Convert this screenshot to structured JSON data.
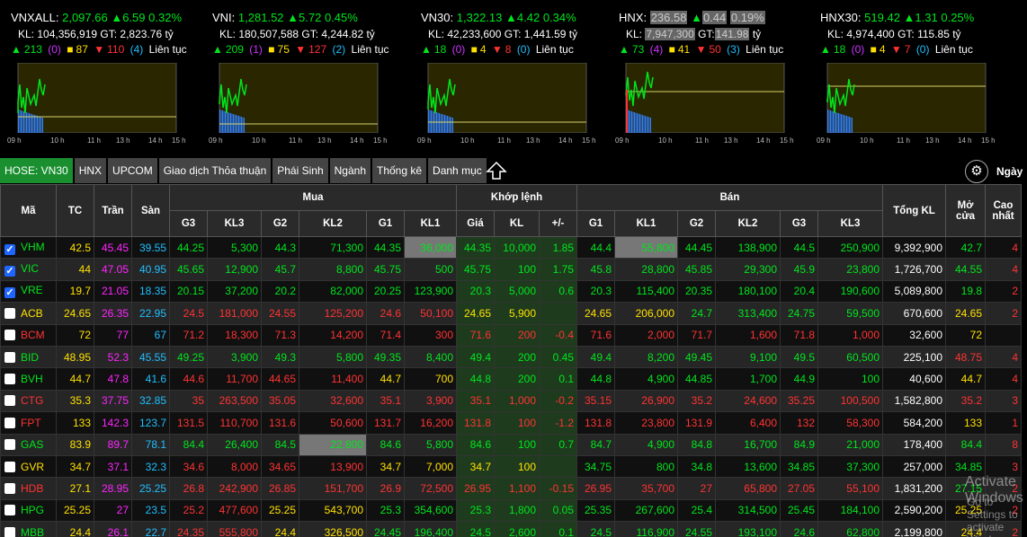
{
  "indices": [
    {
      "name": "VNXALL:",
      "value": "2,097.66",
      "change": "6.59",
      "pct": "0.32%",
      "kl": "KL: 104,356,919 GT: 2,823.76 tỷ",
      "adv": "213",
      "ceilc": "(0)",
      "unch": "87",
      "dec": "110",
      "floorc": "(4)",
      "state": "Liên tục"
    },
    {
      "name": "VNI:",
      "value": "1,281.52",
      "change": "5.72",
      "pct": "0.45%",
      "kl": "KL: 180,507,588 GT: 4,244.82 tỷ",
      "adv": "209",
      "ceilc": "(1)",
      "unch": "75",
      "dec": "127",
      "floorc": "(2)",
      "state": "Liên tục"
    },
    {
      "name": "VN30:",
      "value": "1,322.13",
      "change": "4.42",
      "pct": "0.34%",
      "kl": "KL: 42,233,600 GT: 1,441.59 tỷ",
      "adv": "18",
      "ceilc": "(0)",
      "unch": "4",
      "dec": "8",
      "floorc": "(0)",
      "state": "Liên tục"
    },
    {
      "name": "HNX:",
      "value": "236.58",
      "change": "0.44",
      "pct": "0.19%",
      "kl_a": "KL:",
      "kl_v": "7,947,300",
      "kl_b": "GT:",
      "kl_g": "141.98",
      "kl_c": "tỷ",
      "adv": "73",
      "ceilc": "(4)",
      "unch": "41",
      "dec": "50",
      "floorc": "(3)",
      "state": "Liên tục"
    },
    {
      "name": "HNX30:",
      "value": "519.42",
      "change": "1.31",
      "pct": "0.25%",
      "kl": "KL: 4,974,400 GT: 115.85 tỷ",
      "adv": "18",
      "ceilc": "(0)",
      "unch": "4",
      "dec": "7",
      "floorc": "(0)",
      "state": "Liên tục"
    }
  ],
  "ticks": [
    "09 h",
    "10 h",
    "11 h",
    "13 h",
    "14 h",
    "15 h"
  ],
  "tabs": [
    "HOSE: VN30",
    "HNX",
    "UPCOM",
    "Giao dịch Thỏa thuận",
    "Phái Sinh",
    "Ngành",
    "Thống kê",
    "Danh mục"
  ],
  "ngay": "Ngày",
  "headers": {
    "ma": "Mã",
    "tc": "TC",
    "tran": "Trần",
    "san": "Sàn",
    "mua": "Mua",
    "khop": "Khớp lệnh",
    "ban": "Bán",
    "tongkl": "Tổng KL",
    "mocua": "Mở cửa",
    "cao": "Cao nhất",
    "g3": "G3",
    "kl3": "KL3",
    "g2": "G2",
    "kl2": "KL2",
    "g1": "G1",
    "kl1": "KL1",
    "gia": "Giá",
    "kl": "KL",
    "pm": "+/-"
  },
  "rows": [
    {
      "s": "VHM",
      "chk": true,
      "c": [
        "42.5",
        "45.45",
        "39.55",
        "44.25",
        "5,300",
        "44.3",
        "71,300",
        "44.35",
        "36,000",
        "44.35",
        "10,000",
        "1.85",
        "44.4",
        "55,800",
        "44.45",
        "138,900",
        "44.5",
        "250,900",
        "9,392,900",
        "42.7",
        "4"
      ]
    },
    {
      "s": "VIC",
      "chk": true,
      "c": [
        "44",
        "47.05",
        "40.95",
        "45.65",
        "12,900",
        "45.7",
        "8,800",
        "45.75",
        "500",
        "45.75",
        "100",
        "1.75",
        "45.8",
        "28,800",
        "45.85",
        "29,300",
        "45.9",
        "23,800",
        "1,726,700",
        "44.55",
        "4"
      ]
    },
    {
      "s": "VRE",
      "chk": true,
      "c": [
        "19.7",
        "21.05",
        "18.35",
        "20.15",
        "37,200",
        "20.2",
        "82,000",
        "20.25",
        "123,900",
        "20.3",
        "5,000",
        "0.6",
        "20.3",
        "115,400",
        "20.35",
        "180,100",
        "20.4",
        "190,600",
        "5,089,800",
        "19.8",
        "2"
      ]
    },
    {
      "s": "ACB",
      "chk": false,
      "c": [
        "24.65",
        "26.35",
        "22.95",
        "24.5",
        "181,000",
        "24.55",
        "125,200",
        "24.6",
        "50,100",
        "24.65",
        "5,900",
        "",
        "24.65",
        "206,000",
        "24.7",
        "313,400",
        "24.75",
        "59,500",
        "670,600",
        "24.65",
        "2"
      ]
    },
    {
      "s": "BCM",
      "chk": false,
      "c": [
        "72",
        "77",
        "67",
        "71.2",
        "18,300",
        "71.3",
        "14,200",
        "71.4",
        "300",
        "71.6",
        "200",
        "-0.4",
        "71.6",
        "2,000",
        "71.7",
        "1,600",
        "71.8",
        "1,000",
        "32,600",
        "72",
        ""
      ]
    },
    {
      "s": "BID",
      "chk": false,
      "c": [
        "48.95",
        "52.3",
        "45.55",
        "49.25",
        "3,900",
        "49.3",
        "5,800",
        "49.35",
        "8,400",
        "49.4",
        "200",
        "0.45",
        "49.4",
        "8,200",
        "49.45",
        "9,100",
        "49.5",
        "60,500",
        "225,100",
        "48.75",
        "4"
      ]
    },
    {
      "s": "BVH",
      "chk": false,
      "c": [
        "44.7",
        "47.8",
        "41.6",
        "44.6",
        "11,700",
        "44.65",
        "11,400",
        "44.7",
        "700",
        "44.8",
        "200",
        "0.1",
        "44.8",
        "4,900",
        "44.85",
        "1,700",
        "44.9",
        "100",
        "40,600",
        "44.7",
        "4"
      ]
    },
    {
      "s": "CTG",
      "chk": false,
      "c": [
        "35.3",
        "37.75",
        "32.85",
        "35",
        "263,500",
        "35.05",
        "32,600",
        "35.1",
        "3,900",
        "35.1",
        "1,000",
        "-0.2",
        "35.15",
        "26,900",
        "35.2",
        "24,600",
        "35.25",
        "100,500",
        "1,582,800",
        "35.2",
        "3"
      ]
    },
    {
      "s": "FPT",
      "chk": false,
      "c": [
        "133",
        "142.3",
        "123.7",
        "131.5",
        "110,700",
        "131.6",
        "50,600",
        "131.7",
        "16,200",
        "131.8",
        "100",
        "-1.2",
        "131.8",
        "23,800",
        "131.9",
        "6,400",
        "132",
        "58,300",
        "584,200",
        "133",
        "1"
      ]
    },
    {
      "s": "GAS",
      "chk": false,
      "c": [
        "83.9",
        "89.7",
        "78.1",
        "84.4",
        "26,400",
        "84.5",
        "22,800",
        "84.6",
        "5,800",
        "84.6",
        "100",
        "0.7",
        "84.7",
        "4,900",
        "84.8",
        "16,700",
        "84.9",
        "21,000",
        "178,400",
        "84.4",
        "8"
      ]
    },
    {
      "s": "GVR",
      "chk": false,
      "c": [
        "34.7",
        "37.1",
        "32.3",
        "34.6",
        "8,000",
        "34.65",
        "13,900",
        "34.7",
        "7,000",
        "34.7",
        "100",
        "",
        "34.75",
        "800",
        "34.8",
        "13,600",
        "34.85",
        "37,300",
        "257,000",
        "34.85",
        "3"
      ]
    },
    {
      "s": "HDB",
      "chk": false,
      "c": [
        "27.1",
        "28.95",
        "25.25",
        "26.8",
        "242,900",
        "26.85",
        "151,700",
        "26.9",
        "72,500",
        "26.95",
        "1,100",
        "-0.15",
        "26.95",
        "35,700",
        "27",
        "65,800",
        "27.05",
        "55,100",
        "1,831,200",
        "27.15",
        "2"
      ]
    },
    {
      "s": "HPG",
      "chk": false,
      "c": [
        "25.25",
        "27",
        "23.5",
        "25.2",
        "477,600",
        "25.25",
        "543,700",
        "25.3",
        "354,600",
        "25.3",
        "1,800",
        "0.05",
        "25.35",
        "267,600",
        "25.4",
        "314,500",
        "25.45",
        "184,100",
        "2,590,200",
        "25.25",
        "2"
      ]
    },
    {
      "s": "MBB",
      "chk": false,
      "c": [
        "24.4",
        "26.1",
        "22.7",
        "24.35",
        "555,800",
        "24.4",
        "326,500",
        "24.45",
        "196,400",
        "24.5",
        "2,600",
        "0.1",
        "24.5",
        "116,900",
        "24.55",
        "193,100",
        "24.6",
        "62,800",
        "2,199,800",
        "24.4",
        "2"
      ]
    }
  ],
  "watermark": "Activate Windows",
  "watermark2": "Go to Settings to activate Windows."
}
